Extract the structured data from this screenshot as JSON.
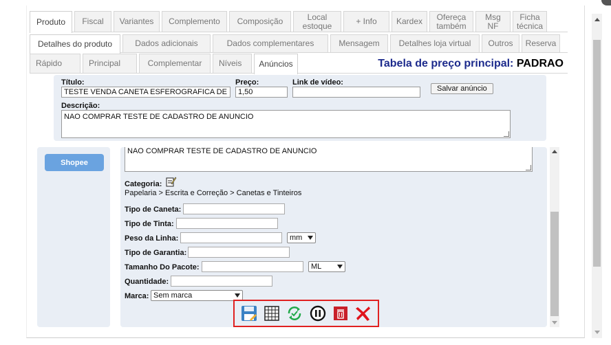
{
  "tabs_main": [
    "Produto",
    "Fiscal",
    "Variantes",
    "Complemento",
    "Composição",
    "Local estoque",
    "+ Info",
    "Kardex",
    "Ofereça também",
    "Msg NF",
    "Ficha técnica"
  ],
  "tabs_detail": [
    "Detalhes do produto",
    "Dados adicionais",
    "Dados complementares",
    "Mensagem",
    "Detalhes loja virtual",
    "Outros",
    "Reserva"
  ],
  "tabs_sub": [
    "Rápido",
    "Principal",
    "Complementar",
    "Níveis",
    "Anúncios"
  ],
  "price_table": {
    "label": "Tabela de preço principal:",
    "value": "PADRAO"
  },
  "ad": {
    "title_label": "Título:",
    "title_value": "TESTE VENDA CANETA ESFEROGRAFICA DE",
    "price_label": "Preço:",
    "price_value": "1,50",
    "video_label": "Link de vídeo:",
    "video_value": "",
    "save_button": "Salvar anúncio",
    "description_label": "Descrição:",
    "description_value": "NAO COMPRAR TESTE DE CADASTRO DE ANUNCIO"
  },
  "marketplace": {
    "button": "Shopee",
    "description_value": "NAO COMPRAR TESTE DE CADASTRO DE ANUNCIO",
    "category_label": "Categoria:",
    "category_path": "Papelaria > Escrita e Correção > Canetas e Tinteiros",
    "fields": {
      "tipo_caneta": "Tipo de Caneta:",
      "tipo_tinta": "Tipo de Tinta:",
      "peso_linha": "Peso da Linha:",
      "peso_unit": "mm",
      "tipo_garantia": "Tipo de Garantia:",
      "tamanho_pacote": "Tamanho Do Pacote:",
      "tamanho_unit": "ML",
      "quantidade": "Quantidade:",
      "marca": "Marca:",
      "marca_value": "Sem marca"
    }
  },
  "toolbar_icons": [
    "save-icon",
    "grid-icon",
    "refresh-icon",
    "pause-icon",
    "delete-icon",
    "close-icon"
  ],
  "colors": {
    "accent_blue": "#1c2a8c",
    "highlight_red": "#e02020",
    "shopee_button": "#6aa3e0",
    "panel_bg": "#e9eef5"
  }
}
